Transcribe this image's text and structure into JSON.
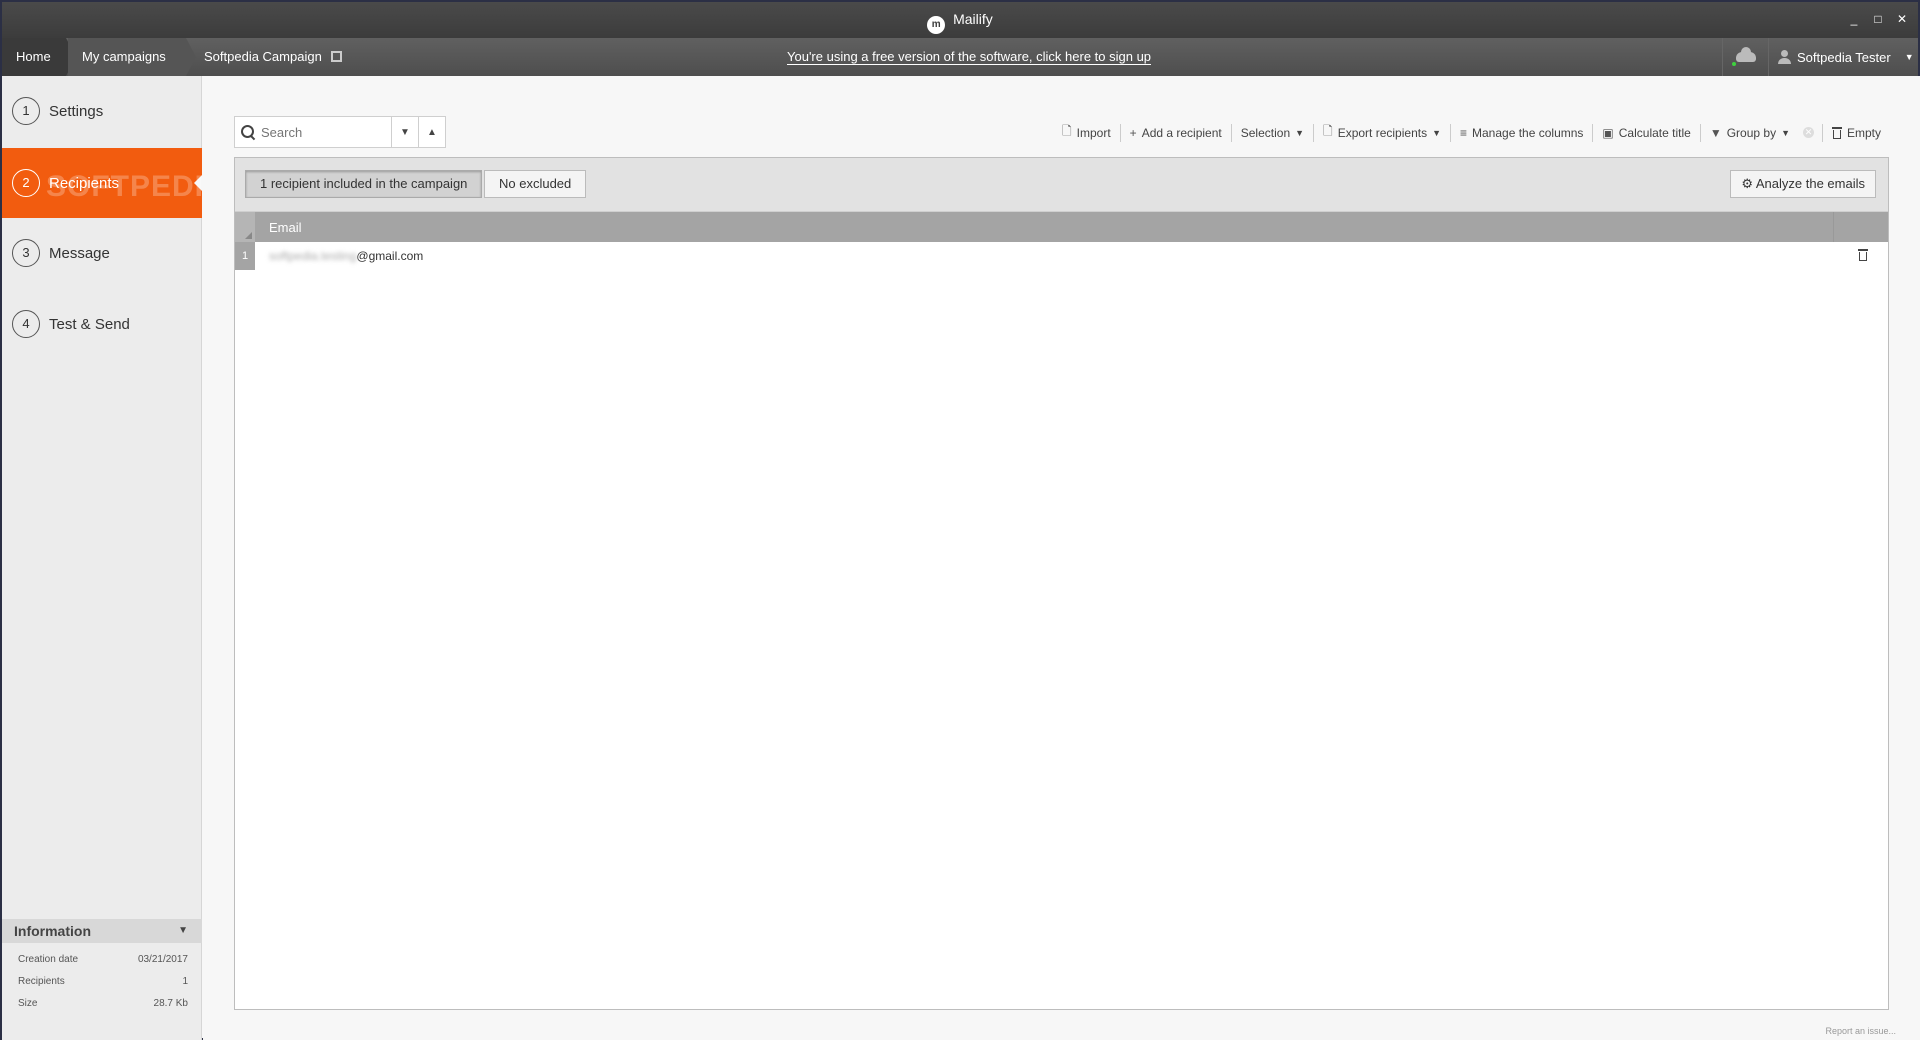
{
  "window": {
    "app_title": "Mailify",
    "logo_text": "m",
    "controls": [
      "_",
      "□",
      "✕"
    ]
  },
  "nav": {
    "home": "Home",
    "campaigns": "My campaigns",
    "current_campaign": "Softpedia Campaign",
    "banner": "You're using a free version of the software, click here to sign up",
    "user": "Softpedia Tester"
  },
  "sidebar": {
    "steps": [
      {
        "num": "1",
        "label": "Settings"
      },
      {
        "num": "2",
        "label": "Recipients"
      },
      {
        "num": "3",
        "label": "Message"
      },
      {
        "num": "4",
        "label": "Test & Send"
      }
    ],
    "watermark": "SOFTPEDIA",
    "info": {
      "title": "Information",
      "rows": [
        {
          "label": "Creation date",
          "value": "03/21/2017"
        },
        {
          "label": "Recipients",
          "value": "1"
        },
        {
          "label": "Size",
          "value": "28.7 Kb"
        }
      ]
    }
  },
  "search": {
    "placeholder": "Search",
    "value": ""
  },
  "toolbar": {
    "import": "Import",
    "add_recipient": "Add a recipient",
    "selection": "Selection",
    "export": "Export recipients",
    "manage_columns": "Manage the columns",
    "calculate_title": "Calculate title",
    "group_by": "Group by",
    "empty": "Empty"
  },
  "panel": {
    "included_tab": "1 recipient included in the campaign",
    "excluded_tab": "No excluded",
    "analyze": "Analyze the emails",
    "column": "Email",
    "rows": [
      {
        "index": "1",
        "email_local": "softpedia.testing",
        "email_domain": "@gmail.com"
      }
    ]
  },
  "footer": {
    "report": "Report an issue..."
  },
  "colors": {
    "accent": "#f25c0f",
    "titlebar": "#3c3c3c",
    "navbar": "#555555"
  }
}
